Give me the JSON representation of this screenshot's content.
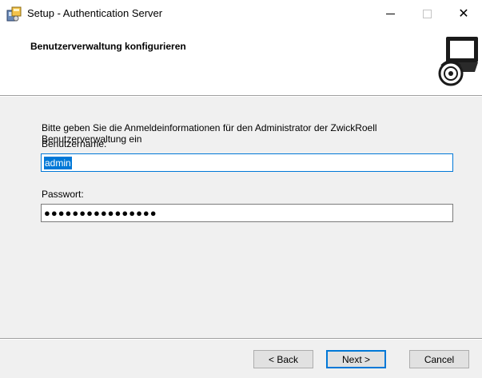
{
  "window": {
    "title": "Setup - Authentication Server"
  },
  "header": {
    "title": "Benutzerverwaltung konfigurieren"
  },
  "form": {
    "description": "Bitte geben Sie die Anmeldeinformationen für den Administrator der ZwickRoell Benutzerverwaltung ein",
    "username_label": "Benutzername:",
    "username_value": "admin",
    "password_label": "Passwort:",
    "password_value": "●●●●●●●●●●●●●●●●"
  },
  "buttons": {
    "back": "< Back",
    "next": "Next >",
    "cancel": "Cancel"
  },
  "icons": {
    "app": "setup-icon",
    "header": "computer-disc-icon"
  },
  "colors": {
    "accent": "#0078d7",
    "selection": "#0078d7",
    "dialog_bg": "#f0f0f0"
  }
}
